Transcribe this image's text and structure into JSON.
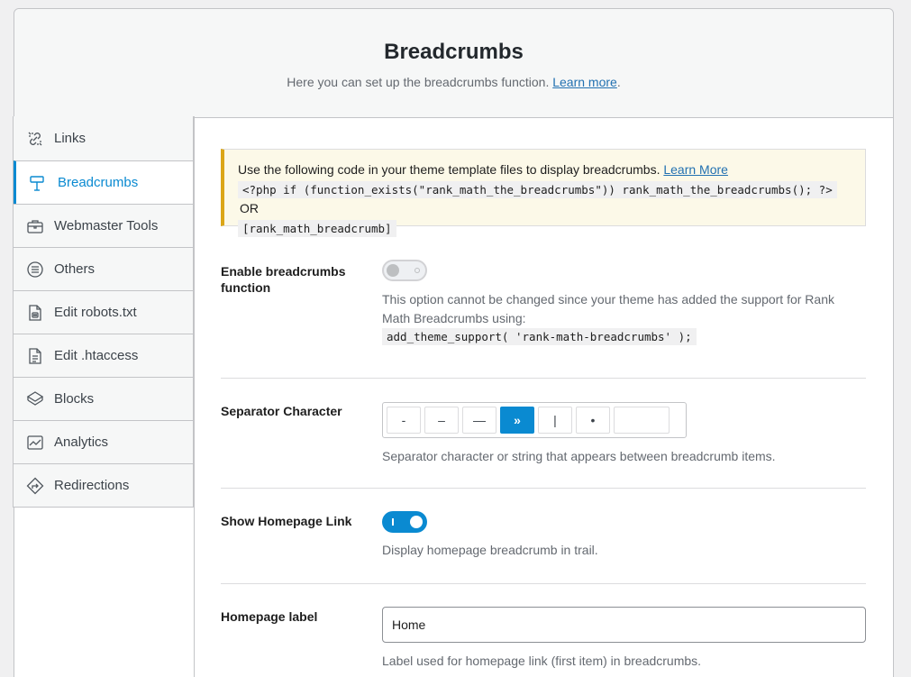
{
  "header": {
    "title": "Breadcrumbs",
    "subtitle": "Here you can set up the breadcrumbs function.",
    "learn_more": "Learn more",
    "period": "."
  },
  "sidebar": {
    "items": [
      {
        "label": "Links",
        "icon": "links-icon",
        "active": false
      },
      {
        "label": "Breadcrumbs",
        "icon": "signpost-icon",
        "active": true
      },
      {
        "label": "Webmaster Tools",
        "icon": "briefcase-icon",
        "active": false
      },
      {
        "label": "Others",
        "icon": "list-circle-icon",
        "active": false
      },
      {
        "label": "Edit robots.txt",
        "icon": "robot-file-icon",
        "active": false
      },
      {
        "label": "Edit .htaccess",
        "icon": "document-icon",
        "active": false
      },
      {
        "label": "Blocks",
        "icon": "cube-icon",
        "active": false
      },
      {
        "label": "Analytics",
        "icon": "chart-icon",
        "active": false
      },
      {
        "label": "Redirections",
        "icon": "redirect-icon",
        "active": false
      }
    ]
  },
  "notice": {
    "text": "Use the following code in your theme template files to display breadcrumbs.",
    "learn_more": "Learn More",
    "code1": "<?php if (function_exists(\"rank_math_the_breadcrumbs\")) rank_math_the_breadcrumbs(); ?>",
    "or": "OR",
    "code2": "[rank_math_breadcrumb]"
  },
  "enable": {
    "label": "Enable breadcrumbs function",
    "enabled": false,
    "desc": "This option cannot be changed since your theme has added the support for Rank Math Breadcrumbs using:",
    "code": "add_theme_support( 'rank-math-breadcrumbs' );"
  },
  "separator": {
    "label": "Separator Character",
    "options": [
      "-",
      "–",
      "—",
      "»",
      "|",
      "•"
    ],
    "selected": "»",
    "custom_value": "",
    "desc": "Separator character or string that appears between breadcrumb items."
  },
  "homepage_link": {
    "label": "Show Homepage Link",
    "enabled": true,
    "desc": "Display homepage breadcrumb in trail."
  },
  "homepage_label": {
    "label": "Homepage label",
    "value": "Home",
    "desc": "Label used for homepage link (first item) in breadcrumbs."
  },
  "colors": {
    "accent": "#0a8ad1",
    "notice_border": "#dba617",
    "link": "#2271b1"
  }
}
